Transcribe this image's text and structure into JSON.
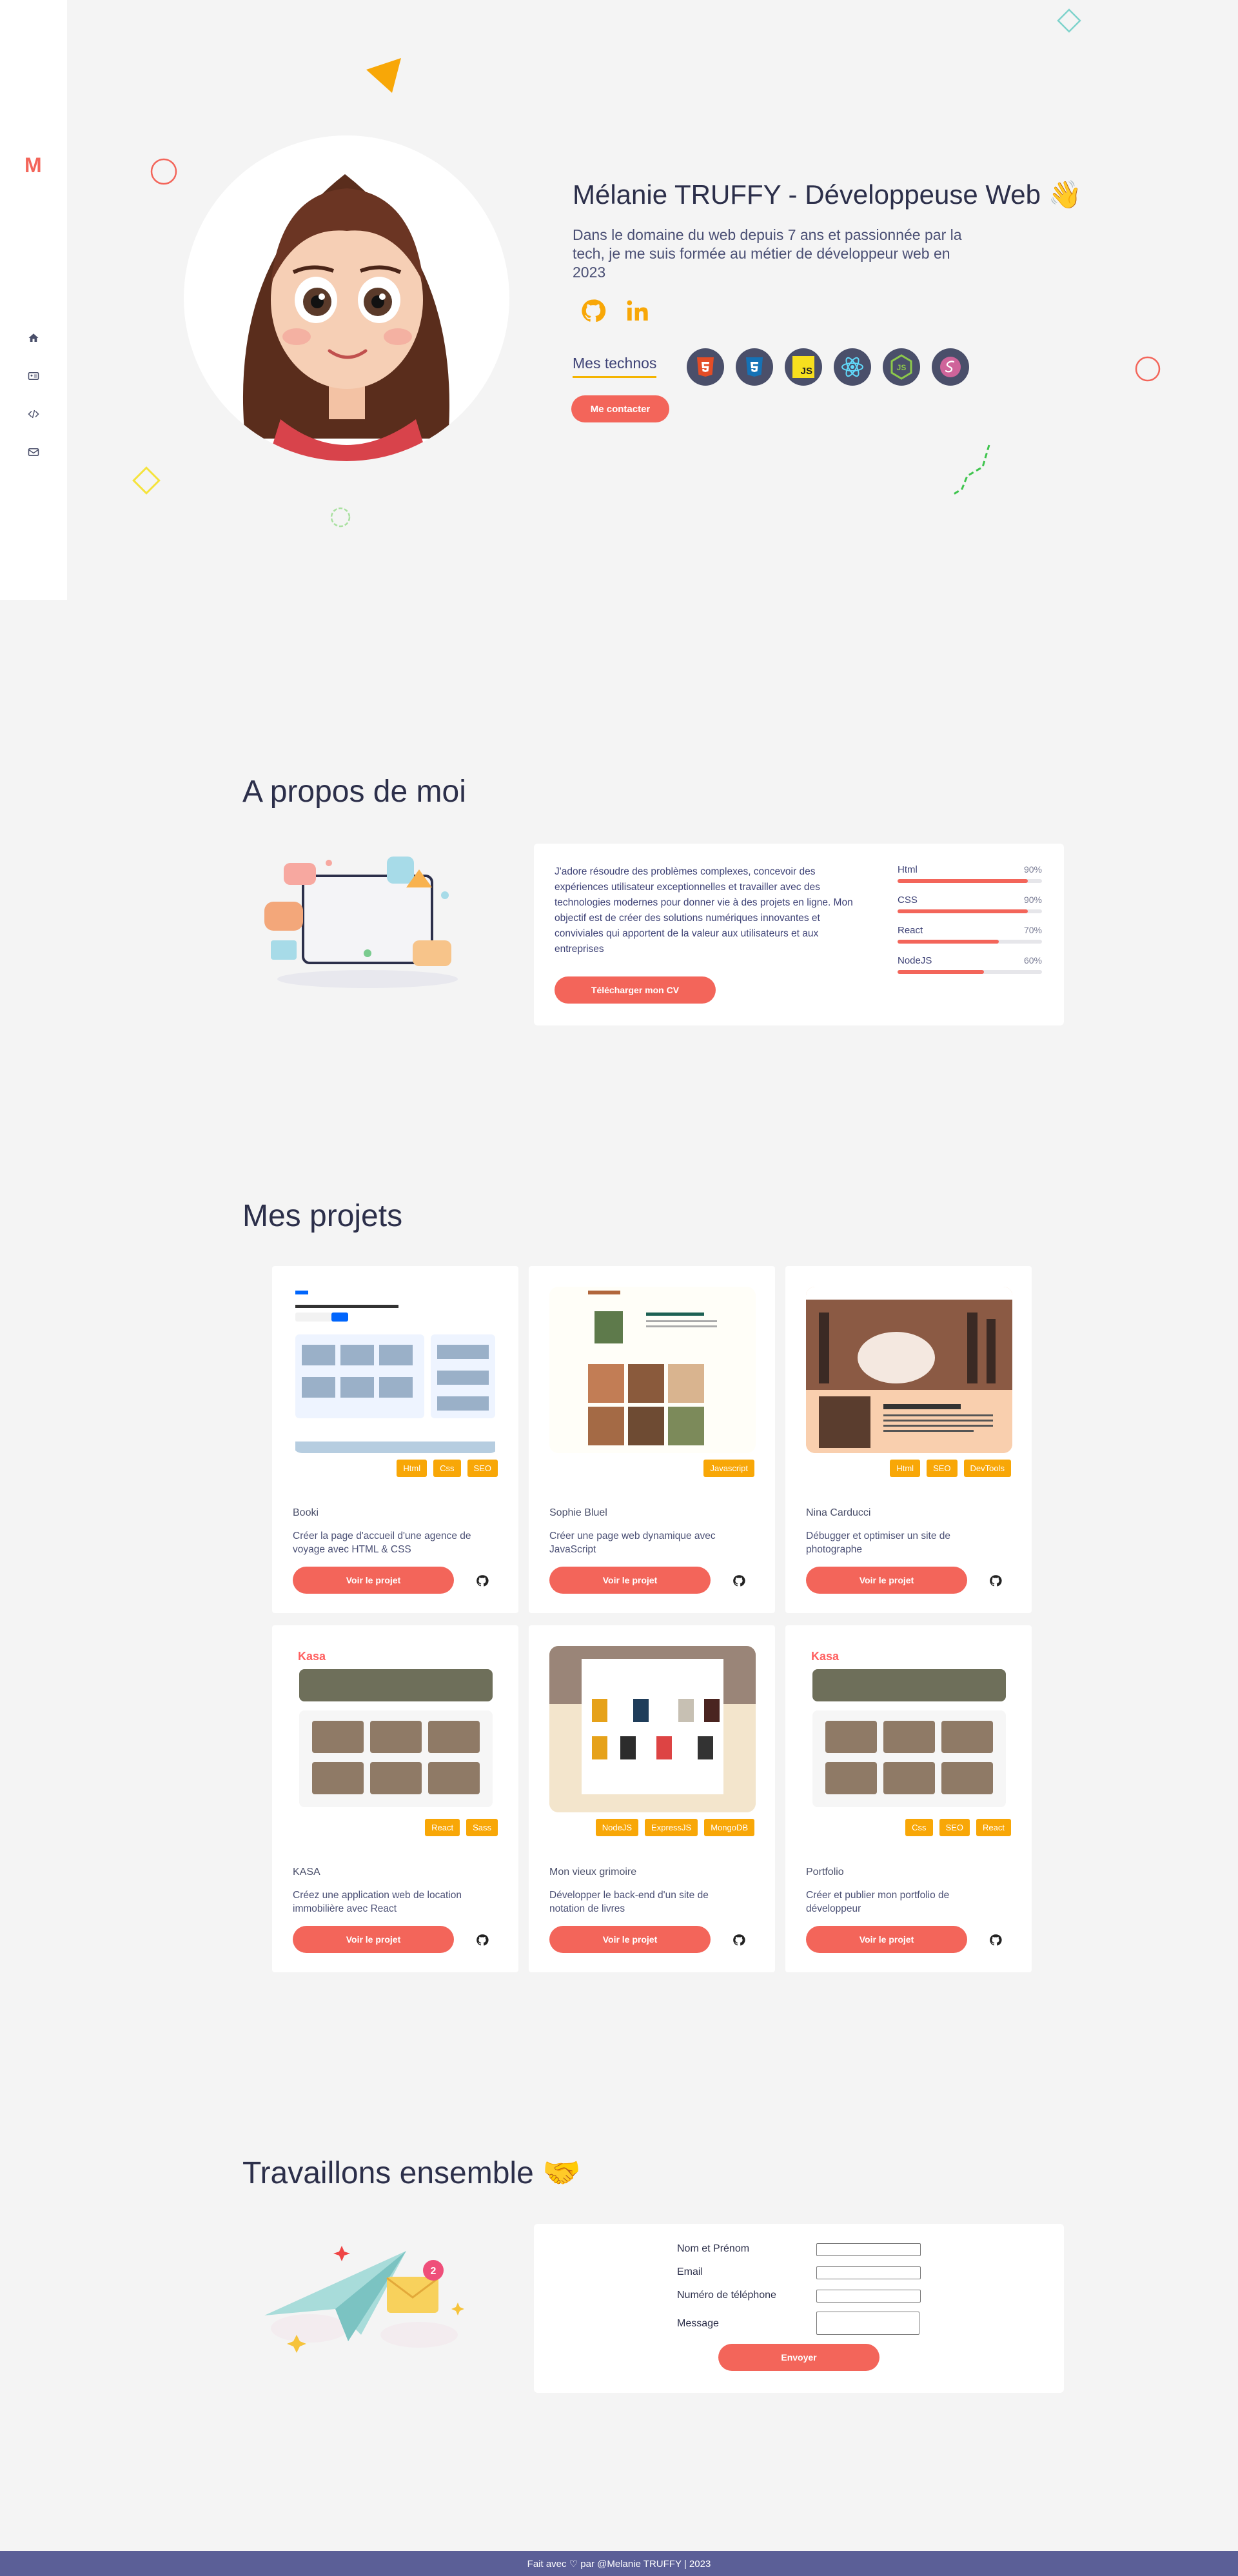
{
  "brand": {
    "logo": "M",
    "accent": "#f3655a",
    "secondary": "#f8a707",
    "footer_bg": "#5b5f97"
  },
  "nav": [
    {
      "icon": "home-icon"
    },
    {
      "icon": "id-card-icon"
    },
    {
      "icon": "code-icon"
    },
    {
      "icon": "envelope-icon"
    }
  ],
  "hero": {
    "title": "Mélanie TRUFFY - Développeuse Web",
    "wave_emoji": "👋",
    "description": "Dans le domaine du web depuis 7 ans et passionnée par la tech, je me suis formée au métier de développeur web en 2023",
    "tech_label": "Mes technos",
    "contact_button": "Me contacter",
    "socials": [
      {
        "icon": "github-icon"
      },
      {
        "icon": "linkedin-icon"
      }
    ],
    "techs": [
      {
        "icon": "html5-icon"
      },
      {
        "icon": "css3-icon"
      },
      {
        "icon": "javascript-icon",
        "text": "JS"
      },
      {
        "icon": "react-icon"
      },
      {
        "icon": "nodejs-icon"
      },
      {
        "icon": "sass-icon"
      }
    ]
  },
  "about": {
    "title": "A propos de moi",
    "text": "J'adore résoudre des problèmes complexes, concevoir des expériences utilisateur exceptionnelles et travailler avec des technologies modernes pour donner vie à des projets en ligne. Mon objectif est de créer des solutions numériques innovantes et conviviales qui apportent de la valeur aux utilisateurs et aux entreprises",
    "cv_button": "Télécharger mon CV",
    "skills": [
      {
        "name": "Html",
        "percent_label": "90%",
        "percent": 90
      },
      {
        "name": "CSS",
        "percent_label": "90%",
        "percent": 90
      },
      {
        "name": "React",
        "percent_label": "70%",
        "percent": 70
      },
      {
        "name": "NodeJS",
        "percent_label": "60%",
        "percent": 60
      }
    ]
  },
  "projects": {
    "title": "Mes projets",
    "view_label": "Voir le projet",
    "items": [
      {
        "name": "Booki",
        "description": "Créer la page d'accueil d'une agence de voyage avec HTML & CSS",
        "tags": [
          "Html",
          "Css",
          "SEO"
        ]
      },
      {
        "name": "Sophie Bluel",
        "description": "Créer une page web dynamique avec JavaScript",
        "tags": [
          "Javascript"
        ]
      },
      {
        "name": "Nina Carducci",
        "description": "Débugger et optimiser un site de photographe",
        "tags": [
          "Html",
          "SEO",
          "DevTools"
        ]
      },
      {
        "name": "KASA",
        "description": "Créez une application web de location immobilière avec React",
        "tags": [
          "React",
          "Sass"
        ]
      },
      {
        "name": "Mon vieux grimoire",
        "description": "Développer le back-end d'un site de notation de livres",
        "tags": [
          "NodeJS",
          "ExpressJS",
          "MongoDB"
        ]
      },
      {
        "name": "Portfolio",
        "description": "Créer et publier mon portfolio de développeur",
        "tags": [
          "Css",
          "SEO",
          "React"
        ]
      }
    ]
  },
  "contact": {
    "title": "Travaillons ensemble",
    "emoji": "🤝",
    "fields": [
      {
        "label": "Nom et Prénom",
        "value": ""
      },
      {
        "label": "Email",
        "value": ""
      },
      {
        "label": "Numéro de téléphone",
        "value": ""
      },
      {
        "label": "Message",
        "value": ""
      }
    ],
    "send_button": "Envoyer"
  },
  "footer": {
    "text": "Fait avec ♡ par @Melanie TRUFFY | 2023"
  }
}
